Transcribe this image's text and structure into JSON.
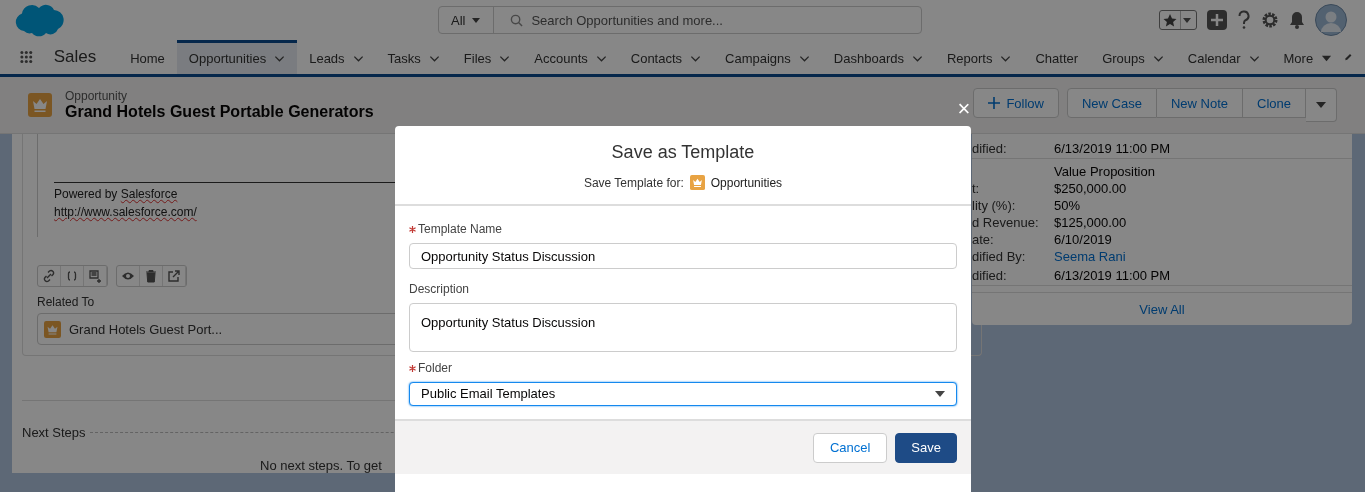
{
  "header": {
    "search_scope": "All",
    "search_placeholder": "Search Opportunities and more..."
  },
  "nav": {
    "app_name": "Sales",
    "tabs": [
      {
        "label": "Home",
        "selected": false,
        "kind": "plain"
      },
      {
        "label": "Opportunities",
        "selected": true,
        "kind": "menu"
      },
      {
        "label": "Leads",
        "selected": false,
        "kind": "menu"
      },
      {
        "label": "Tasks",
        "selected": false,
        "kind": "menu"
      },
      {
        "label": "Files",
        "selected": false,
        "kind": "menu"
      },
      {
        "label": "Accounts",
        "selected": false,
        "kind": "menu"
      },
      {
        "label": "Contacts",
        "selected": false,
        "kind": "menu"
      },
      {
        "label": "Campaigns",
        "selected": false,
        "kind": "menu"
      },
      {
        "label": "Dashboards",
        "selected": false,
        "kind": "menu"
      },
      {
        "label": "Reports",
        "selected": false,
        "kind": "menu"
      },
      {
        "label": "Chatter",
        "selected": false,
        "kind": "plain"
      },
      {
        "label": "Groups",
        "selected": false,
        "kind": "menu"
      },
      {
        "label": "Calendar",
        "selected": false,
        "kind": "menu"
      },
      {
        "label": "More",
        "selected": false,
        "kind": "more"
      }
    ]
  },
  "record": {
    "object": "Opportunity",
    "title": "Grand Hotels Guest Portable Generators",
    "actions": [
      {
        "label": "Follow",
        "kind": "follow"
      },
      {
        "label": "New Case",
        "kind": "plain"
      },
      {
        "label": "New Note",
        "kind": "plain"
      },
      {
        "label": "Clone",
        "kind": "plain"
      }
    ]
  },
  "email": {
    "footer": "Powered by Salesforce",
    "url": "http://www.salesforce.com/",
    "related_label": "Related To",
    "related_value": "Grand Hotels Guest Port..."
  },
  "next_steps": {
    "heading": "Next Steps",
    "empty": "No next steps. To get"
  },
  "details": {
    "rows": [
      {
        "label": "dified:",
        "value": "6/13/2019 11:00 PM",
        "kind": "text"
      },
      {
        "label": "",
        "value": "Value Proposition",
        "kind": "text"
      },
      {
        "label": "t:",
        "value": "$250,000.00",
        "kind": "text"
      },
      {
        "label": "lity (%):",
        "value": "50%",
        "kind": "text"
      },
      {
        "label": "d Revenue:",
        "value": "$125,000.00",
        "kind": "text"
      },
      {
        "label": "ate:",
        "value": "6/10/2019",
        "kind": "text"
      },
      {
        "label": "dified By:",
        "value": "Seema Rani",
        "kind": "link"
      },
      {
        "label": "dified:",
        "value": "6/13/2019 11:00 PM",
        "kind": "text"
      }
    ],
    "footer_link": "View All"
  },
  "modal": {
    "title": "Save as Template",
    "for_label": "Save Template for:",
    "for_object": "Opportunities",
    "close": "×",
    "fields": [
      {
        "label": "Template Name",
        "required": true,
        "kind": "input",
        "value": "Opportunity Status Discussion"
      },
      {
        "label": "Description",
        "required": false,
        "kind": "textarea",
        "value": "Opportunity Status Discussion"
      },
      {
        "label": "Folder",
        "required": true,
        "kind": "select",
        "value": "Public Email Templates"
      }
    ],
    "buttons": [
      {
        "label": "Cancel",
        "kind": "neutral"
      },
      {
        "label": "Save",
        "kind": "brand"
      }
    ]
  }
}
